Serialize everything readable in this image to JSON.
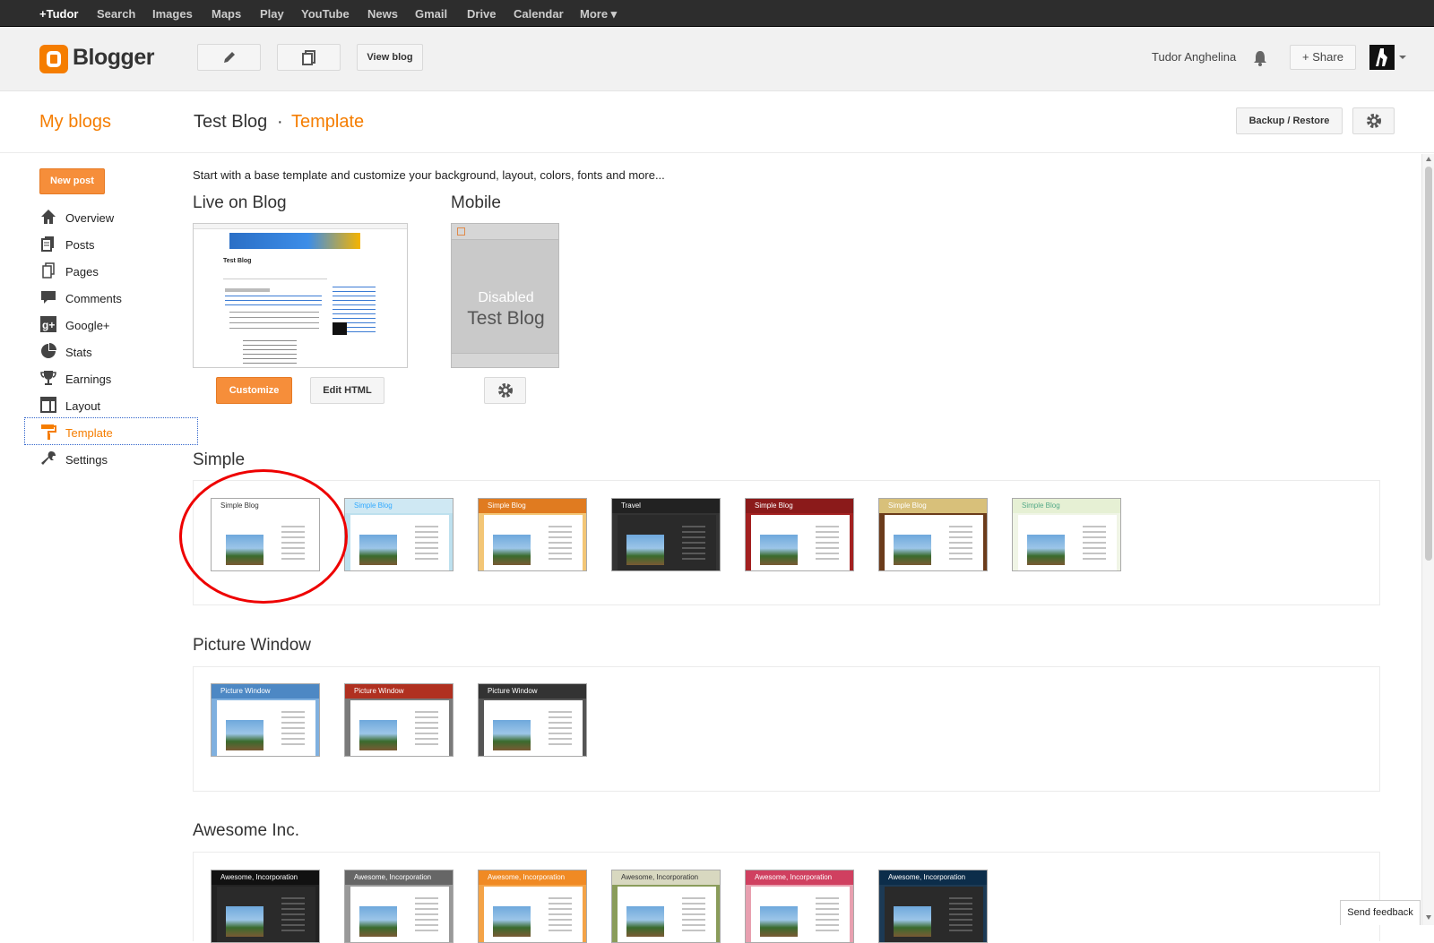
{
  "gbar": {
    "links": [
      "+Tudor",
      "Search",
      "Images",
      "Maps",
      "Play",
      "YouTube",
      "News",
      "Gmail",
      "Drive",
      "Calendar",
      "More ▾"
    ]
  },
  "header": {
    "brand": "Blogger",
    "view_blog": "View blog",
    "user_name": "Tudor Anghelina",
    "share": "+  Share",
    "icons": [
      "pencil-icon",
      "pages-icon",
      "bell-icon",
      "avatar"
    ]
  },
  "titlebar": {
    "my_blogs": "My blogs",
    "blog_name": "Test Blog",
    "separator": "·",
    "section": "Template",
    "backup_restore": "Backup / Restore"
  },
  "sidebar": {
    "new_post": "New post",
    "items": [
      {
        "label": "Overview",
        "icon": "home-icon"
      },
      {
        "label": "Posts",
        "icon": "posts-icon"
      },
      {
        "label": "Pages",
        "icon": "pages-icon"
      },
      {
        "label": "Comments",
        "icon": "comments-icon"
      },
      {
        "label": "Google+",
        "icon": "google-plus-icon"
      },
      {
        "label": "Stats",
        "icon": "stats-icon"
      },
      {
        "label": "Earnings",
        "icon": "trophy-icon"
      },
      {
        "label": "Layout",
        "icon": "layout-icon"
      },
      {
        "label": "Template",
        "icon": "paint-roller-icon",
        "active": true
      },
      {
        "label": "Settings",
        "icon": "wrench-icon"
      }
    ]
  },
  "main": {
    "intro": "Start with a base template and customize your background, layout, colors, fonts and more...",
    "live_heading": "Live on Blog",
    "mobile_heading": "Mobile",
    "live_preview_title": "Test Blog",
    "mobile_disabled": "Disabled",
    "mobile_blog_name": "Test Blog",
    "customize": "Customize",
    "edit_html": "Edit HTML",
    "groups": [
      {
        "name": "Simple",
        "themes": [
          {
            "label": "Simple Blog",
            "bar": "#ffffff",
            "bg": "#ffffff",
            "text": "#333333"
          },
          {
            "label": "Simple Blog",
            "bar": "#cfe8f3",
            "bg": "#bde0ee",
            "text": "#33aaff"
          },
          {
            "label": "Simple Blog",
            "bar": "#e07b20",
            "bg": "#f3c676",
            "text": "#ffffff"
          },
          {
            "label": "Travel",
            "bar": "#222222",
            "bg": "#333333",
            "text": "#ffffff"
          },
          {
            "label": "Simple Blog",
            "bar": "#8b1a1a",
            "bg": "#a32020",
            "text": "#ffffff"
          },
          {
            "label": "Simple Blog",
            "bar": "#d8c07a",
            "bg": "#6b3b1a",
            "text": "#ffffff"
          },
          {
            "label": "Simple Blog",
            "bar": "#e6f0d4",
            "bg": "#f0f5e6",
            "text": "#55aa88"
          }
        ]
      },
      {
        "name": "Picture Window",
        "themes": [
          {
            "label": "Picture Window",
            "bar": "#4d88c4",
            "bg": "#7fb0df",
            "text": "#ffffff"
          },
          {
            "label": "Picture Window",
            "bar": "#b03020",
            "bg": "#7a7a7a",
            "text": "#ffffff"
          },
          {
            "label": "Picture Window",
            "bar": "#333333",
            "bg": "#555555",
            "text": "#ffffff"
          }
        ]
      },
      {
        "name": "Awesome Inc.",
        "themes": [
          {
            "label": "Awesome, Incorporation",
            "bar": "#111111",
            "bg": "#222222",
            "text": "#ffffff"
          },
          {
            "label": "Awesome, Incorporation",
            "bar": "#666666",
            "bg": "#999999",
            "text": "#ffffff"
          },
          {
            "label": "Awesome, Incorporation",
            "bar": "#f08a24",
            "bg": "#f4a347",
            "text": "#ffffff"
          },
          {
            "label": "Awesome, Incorporation",
            "bar": "#d8d8c0",
            "bg": "#8a9c5a",
            "text": "#333333"
          },
          {
            "label": "Awesome, Incorporation",
            "bar": "#d04060",
            "bg": "#e8a0b0",
            "text": "#ffffff"
          },
          {
            "label": "Awesome, Incorporation",
            "bar": "#0c2d4a",
            "bg": "#1c3a55",
            "text": "#ffffff"
          }
        ]
      }
    ]
  },
  "feedback": "Send feedback",
  "colors": {
    "accent": "#f57d00",
    "button_orange": "#f68e3a",
    "highlight_red": "#e00000"
  }
}
